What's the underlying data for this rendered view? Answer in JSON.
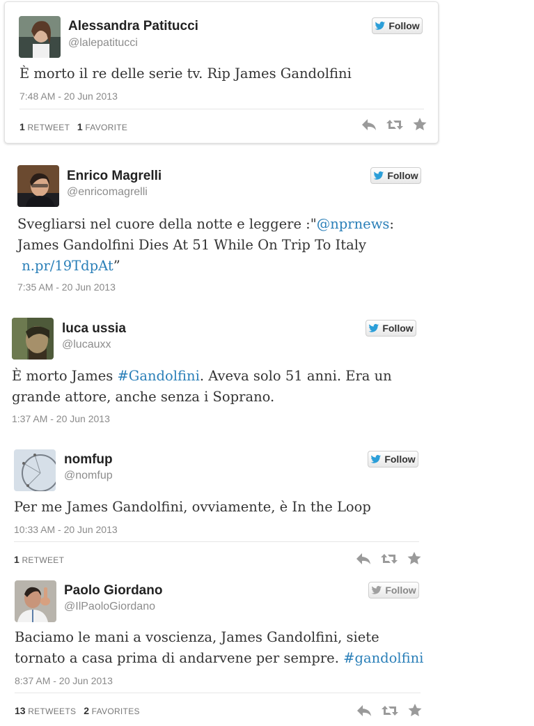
{
  "follow_label": "Follow",
  "tweets": [
    {
      "name": "Alessandra Patitucci",
      "handle": "@lalepatitucci",
      "text_parts": [
        "È morto il re delle serie tv. Rip James Gandolfini"
      ],
      "time": "7:48 AM - 20 Jun 2013",
      "retweets": "1",
      "retweets_label": "RETWEET",
      "favorites": "1",
      "favorites_label": "FAVORITE"
    },
    {
      "name": "Enrico Magrelli",
      "handle": "@enricomagrelli",
      "text_parts": [
        "Svegliarsi nel cuore della notte e leggere :\"",
        "@nprnews",
        ":",
        "James Gandolfini Dies At 51 While On Trip To Italy",
        "n.pr/19TdpAt",
        "”"
      ],
      "time": "7:35 AM - 20 Jun 2013"
    },
    {
      "name": "luca ussia",
      "handle": "@lucauxx",
      "text_parts": [
        "È morto James ",
        "#Gandolfini",
        ". Aveva solo 51 anni. Era un",
        "grande attore, anche senza i Soprano."
      ],
      "time": "1:37 AM - 20 Jun 2013"
    },
    {
      "name": "nomfup",
      "handle": "@nomfup",
      "text_parts": [
        "Per me James Gandolfini, ovviamente, è In the Loop"
      ],
      "time": "10:33 AM - 20 Jun 2013",
      "retweets": "1",
      "retweets_label": "RETWEET"
    },
    {
      "name": "Paolo Giordano",
      "handle": "@IlPaoloGiordano",
      "text_parts": [
        "Baciamo le mani a voscienza, James Gandolfini, siete",
        "tornato a casa prima di andarvene per sempre. ",
        "#gandolfini"
      ],
      "time": "8:37 AM - 20 Jun 2013",
      "retweets": "13",
      "retweets_label": "RETWEETS",
      "favorites": "2",
      "favorites_label": "FAVORITES"
    }
  ]
}
